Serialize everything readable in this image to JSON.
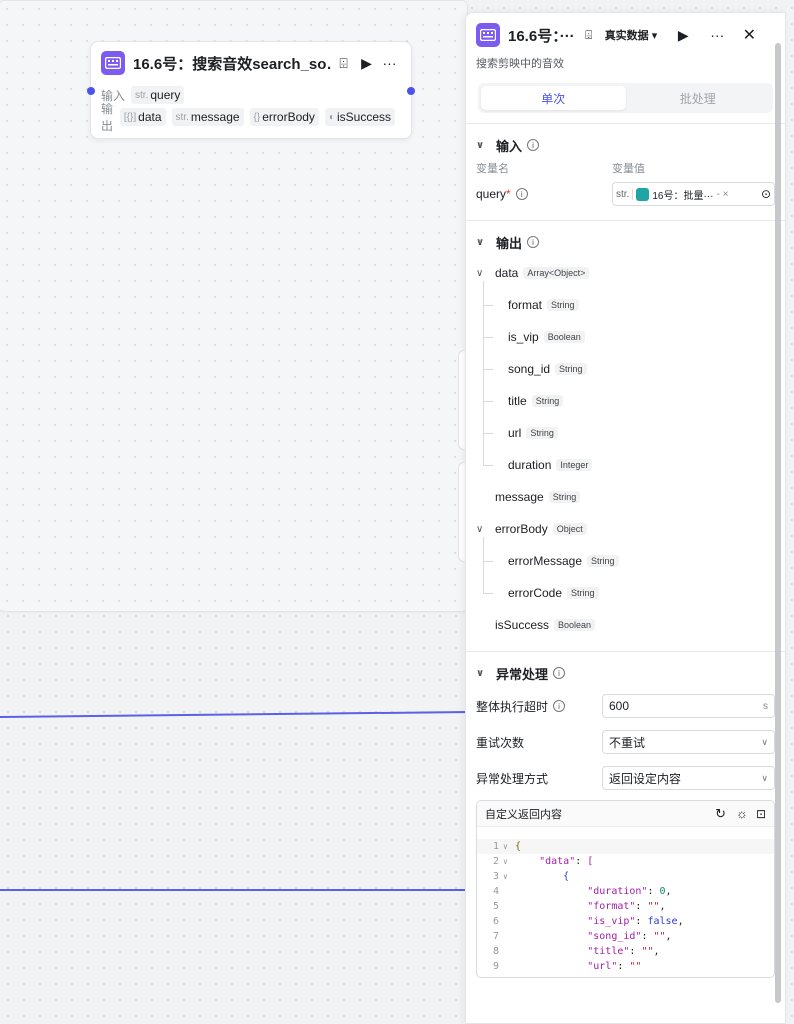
{
  "node": {
    "title": "16.6号：搜索音效search_so…",
    "input_label": "输入",
    "output_label": "输出",
    "inputs": [
      {
        "prefix": "str.",
        "name": "query"
      }
    ],
    "outputs": [
      {
        "prefix": "[{}]",
        "name": "data"
      },
      {
        "prefix": "str.",
        "name": "message"
      },
      {
        "prefix": "{}",
        "name": "errorBody"
      },
      {
        "prefix": "◐",
        "name": "isSuccess"
      }
    ]
  },
  "panel": {
    "title": "16.6号：···",
    "mode_label": "真实数据",
    "description": "搜索剪映中的音效",
    "tabs": {
      "single": "单次",
      "batch": "批处理"
    },
    "input_section": {
      "title": "输入",
      "col_name": "变量名",
      "col_value": "变量值",
      "param": {
        "name": "query",
        "required_mark": "*",
        "value_prefix": "str.",
        "value_ref": "16号：批量···",
        "value_suffix": "- ×"
      }
    },
    "output_section": {
      "title": "输出",
      "fields": [
        {
          "name": "data",
          "type": "Array<Object>",
          "level": 0,
          "expandable": true
        },
        {
          "name": "format",
          "type": "String",
          "level": 1
        },
        {
          "name": "is_vip",
          "type": "Boolean",
          "level": 1
        },
        {
          "name": "song_id",
          "type": "String",
          "level": 1
        },
        {
          "name": "title",
          "type": "String",
          "level": 1
        },
        {
          "name": "url",
          "type": "String",
          "level": 1
        },
        {
          "name": "duration",
          "type": "Integer",
          "level": 1
        },
        {
          "name": "message",
          "type": "String",
          "level": 0
        },
        {
          "name": "errorBody",
          "type": "Object",
          "level": 0,
          "expandable": true
        },
        {
          "name": "errorMessage",
          "type": "String",
          "level": 1
        },
        {
          "name": "errorCode",
          "type": "String",
          "level": 1
        },
        {
          "name": "isSuccess",
          "type": "Boolean",
          "level": 0
        }
      ]
    },
    "error_section": {
      "title": "异常处理",
      "timeout_label": "整体执行超时",
      "timeout_value": "600",
      "timeout_unit": "s",
      "retry_label": "重试次数",
      "retry_value": "不重试",
      "handling_label": "异常处理方式",
      "handling_value": "返回设定内容",
      "custom_return_label": "自定义返回内容"
    },
    "code_lines": [
      {
        "no": "1",
        "fold": "∨",
        "html": "<span class=\"p\">{</span>"
      },
      {
        "no": "2",
        "fold": "∨",
        "html": "    <span class=\"k\">\"data\"</span>: <span class=\"k\">[</span>"
      },
      {
        "no": "3",
        "fold": "∨",
        "html": "        <span class=\"b\">{</span>"
      },
      {
        "no": "4",
        "fold": "",
        "html": "            <span class=\"k\">\"duration\"</span>: <span class=\"n\">0</span>,"
      },
      {
        "no": "5",
        "fold": "",
        "html": "            <span class=\"k\">\"format\"</span>: <span class=\"s\">\"\"</span>,"
      },
      {
        "no": "6",
        "fold": "",
        "html": "            <span class=\"k\">\"is_vip\"</span>: <span class=\"b\">false</span>,"
      },
      {
        "no": "7",
        "fold": "",
        "html": "            <span class=\"k\">\"song_id\"</span>: <span class=\"s\">\"\"</span>,"
      },
      {
        "no": "8",
        "fold": "",
        "html": "            <span class=\"k\">\"title\"</span>: <span class=\"s\">\"\"</span>,"
      },
      {
        "no": "9",
        "fold": "",
        "html": "            <span class=\"k\">\"url\"</span>: <span class=\"s\">\"\"</span>"
      }
    ]
  },
  "colors": {
    "accent": "#4d53e8",
    "node_icon": "#7c5cf0",
    "ref_badge": "#1fa5a5"
  }
}
